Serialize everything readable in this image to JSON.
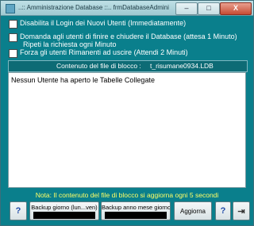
{
  "window": {
    "title": "..:: Amministrazione Database ::.. frmDatabaseAdministration © ing. Carlo Sc...",
    "minimize_glyph": "–",
    "maximize_glyph": "□",
    "close_glyph": "X"
  },
  "options": [
    {
      "label": "Disabilita il Login dei Nuovi Utenti (Immediatamente)"
    },
    {
      "label": "Domanda agli utenti di finire e chiudere il Database (attesa 1 Minuto)",
      "label2": "Ripeti la richiesta ogni Minuto"
    },
    {
      "label": "Forza gli utenti Rimanenti ad uscire  (Attendi 2 Minuti)"
    }
  ],
  "lock_file": {
    "header_label": "Contenuto del file di blocco :",
    "file_name": "t_risumane0934.LDB",
    "content": "Nessun Utente ha aperto le Tabelle Collegate"
  },
  "note": "Nota: Il contenuto del file di blocco si aggiorna ogni 5 secondi",
  "buttons": {
    "help_glyph": "?",
    "backup_day": "Backup giorno (lun...ven)",
    "backup_year": "Backup anno mese giorno",
    "refresh": "Aggiorna",
    "info_glyph": "?",
    "exit_glyph": "⇥"
  },
  "colors": {
    "window_bg": "#0a7f8c",
    "note_text": "#ffff66"
  }
}
